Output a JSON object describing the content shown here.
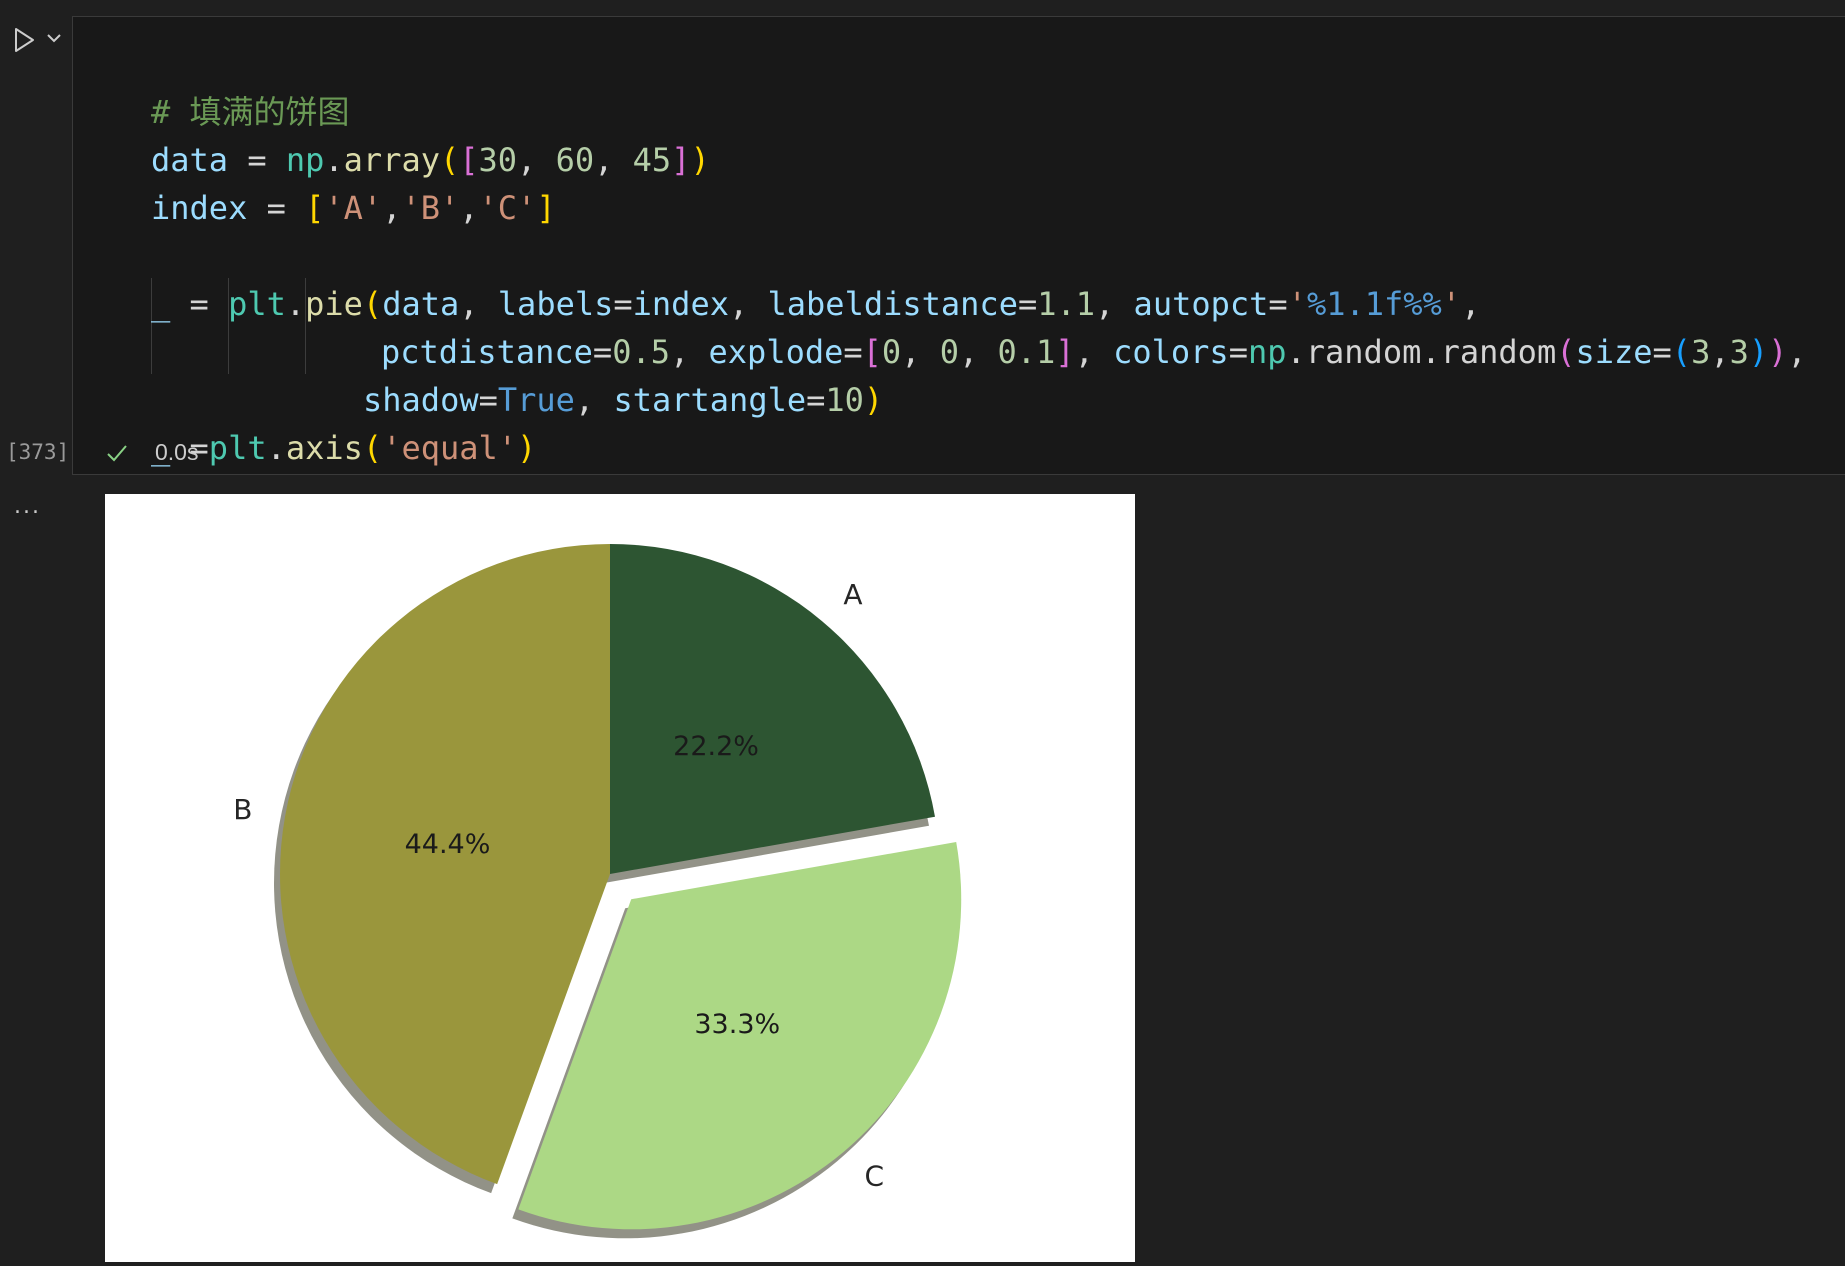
{
  "cell": {
    "execution_count": "[373]",
    "exec_time": "0.0s",
    "output_menu": "...",
    "code": {
      "comment": "# 填满的饼图",
      "line2": {
        "var": "data",
        "eq": " = ",
        "ns": "np",
        "dot": ".",
        "fn": "array",
        "open1": "(",
        "open2": "[",
        "n1": "30",
        "c1": ", ",
        "n2": "60",
        "c2": ", ",
        "n3": "45",
        "close2": "]",
        "close1": ")"
      },
      "line3": {
        "var": "index",
        "eq": " = ",
        "open": "[",
        "s1": "'A'",
        "c1": ",",
        "s2": "'B'",
        "c2": ",",
        "s3": "'C'",
        "close": "]"
      },
      "line5": {
        "us": "_",
        "eq": " = ",
        "ns": "plt",
        "dot": ".",
        "fn": "pie",
        "open": "(",
        "a1": "data",
        "c1": ", ",
        "k1": "labels",
        "e1": "=",
        "v1": "index",
        "c2": ", ",
        "k2": "labeldistance",
        "e2": "=",
        "v2": "1.1",
        "c3": ", ",
        "k3": "autopct",
        "e3": "=",
        "s_open": "'",
        "s_fmt": "%1.1f",
        "s_esc": "%%",
        "s_close": "'",
        "c4": ","
      },
      "line6": {
        "k1": "pctdistance",
        "e1": "=",
        "v1": "0.5",
        "c1": ", ",
        "k2": "explode",
        "e2": "=",
        "o1": "[",
        "n1": "0",
        "sep1": ", ",
        "n2": "0",
        "sep2": ", ",
        "n3": "0.1",
        "cl1": "]",
        "c2": ", ",
        "k3": "colors",
        "e3": "=",
        "ns": "np",
        "dot1": ".",
        "m1": "random",
        "dot2": ".",
        "fn": "random",
        "o2": "(",
        "k4": "size",
        "e4": "=",
        "o3": "(",
        "n4": "3",
        "sep3": ",",
        "n5": "3",
        "cl3": ")",
        "cl2": ")",
        "c3": ","
      },
      "line7": {
        "k1": "shadow",
        "e1": "=",
        "v1": "True",
        "c1": ", ",
        "k2": "startangle",
        "e2": "=",
        "v2": "10",
        "close": ")"
      },
      "line8": {
        "us": "_",
        "eq": " =",
        "ns": "plt",
        "dot": ".",
        "fn": "axis",
        "open": "(",
        "str": "'equal'",
        "close": ")"
      }
    }
  },
  "chart_data": {
    "type": "pie",
    "categories": [
      "A",
      "B",
      "C"
    ],
    "values": [
      30,
      60,
      45
    ],
    "percent_labels": [
      "22.2%",
      "44.4%",
      "33.3%"
    ],
    "colors": [
      "#2d5532",
      "#9a963c",
      "#acd885"
    ],
    "explode": [
      0,
      0,
      0.1
    ],
    "startangle": 10,
    "shadow": true,
    "labeldistance": 1.1,
    "pctdistance": 0.5
  }
}
